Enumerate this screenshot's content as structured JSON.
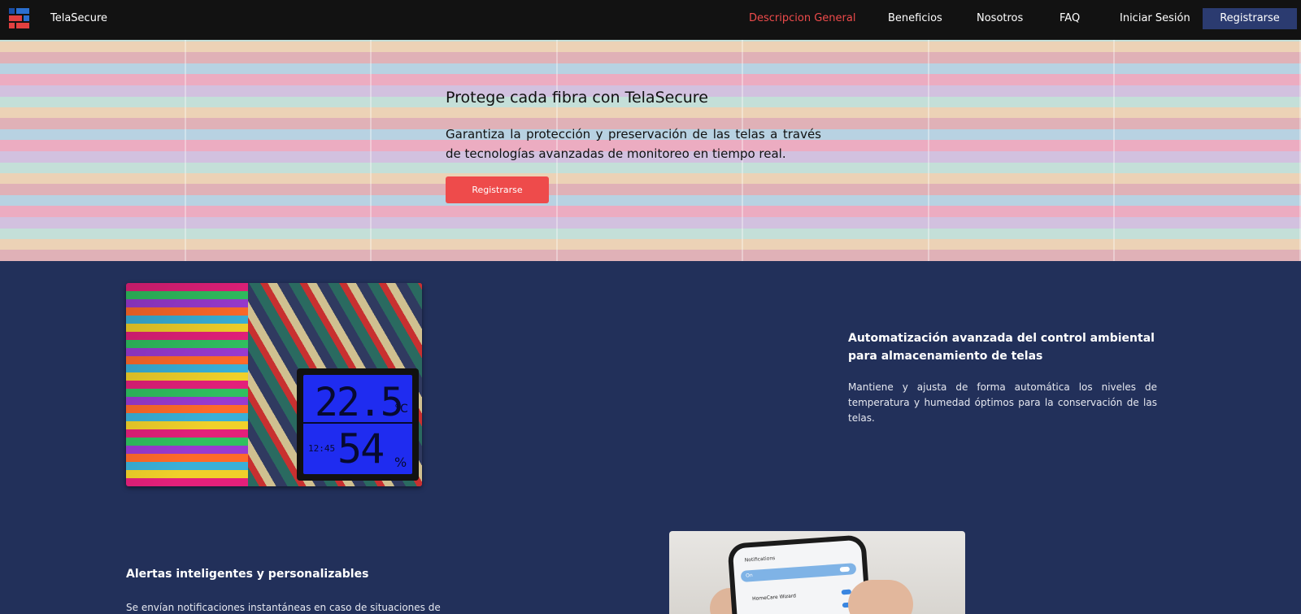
{
  "nav": {
    "brand": "TelaSecure",
    "links": [
      {
        "label": "Descripcion General",
        "active": true
      },
      {
        "label": "Beneficios",
        "active": false
      },
      {
        "label": "Nosotros",
        "active": false
      },
      {
        "label": "FAQ",
        "active": false
      },
      {
        "label": "Iniciar Sesión",
        "active": false
      }
    ],
    "register_label": "Registrarse"
  },
  "hero": {
    "title": "Protege cada fibra con TelaSecure",
    "text": "Garantiza la protección y preservación de las telas a través de tecnologías avanzadas de monitoreo en tiempo real.",
    "button_label": "Registrarse"
  },
  "feature1": {
    "title": "Automatización avanzada del control ambiental para almacenamiento de telas",
    "text": "Mantiene y ajusta de forma automática los niveles de temperatura y humedad óptimos para la conservación de las telas.",
    "device": {
      "temperature": "22.5",
      "temp_unit": "°C",
      "time": "12:45",
      "humidity": "54",
      "hum_unit": "%"
    }
  },
  "feature2": {
    "title": "Alertas inteligentes y personalizables",
    "text": "Se envían notificaciones instantáneas en caso de situaciones de",
    "phone": {
      "header": "Notifications",
      "toggle_label": "On",
      "row1": "HomeCare Wizard"
    }
  },
  "colors": {
    "accent": "#ee4b4b",
    "nav_bg": "#121212",
    "section_bg": "#22305a",
    "register_bg": "#2b3b70"
  }
}
